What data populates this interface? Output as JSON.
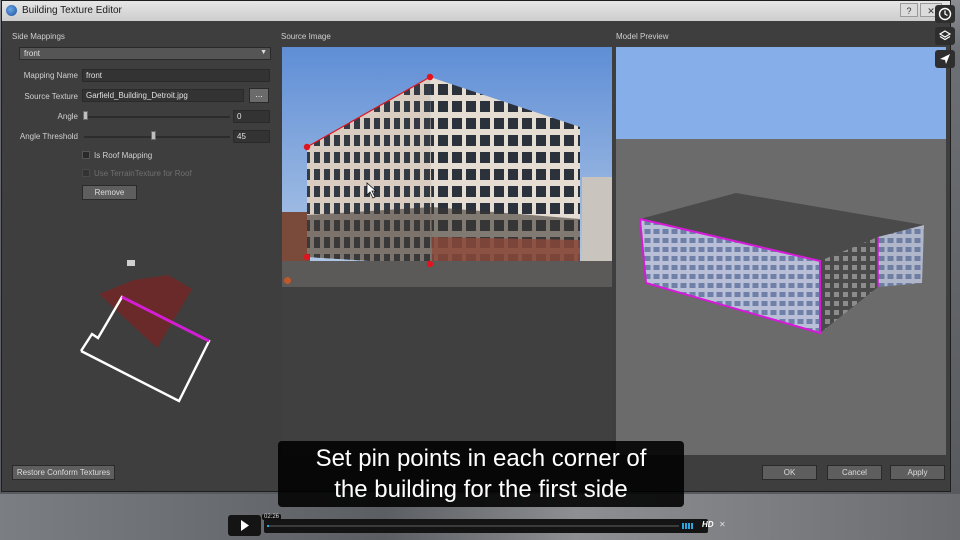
{
  "window": {
    "title": "Building Texture Editor",
    "help_glyph": "?",
    "close_glyph": "✕"
  },
  "side_mappings": {
    "header": "Side Mappings",
    "selected_side": "front",
    "mapping_name_label": "Mapping Name",
    "mapping_name_value": "front",
    "source_texture_label": "Source Texture",
    "source_texture_value": "Garfield_Building_Detroit.jpg",
    "browse_label": "...",
    "angle_label": "Angle",
    "angle_value": "0",
    "angle_threshold_label": "Angle Threshold",
    "angle_threshold_value": "45",
    "is_roof_mapping_label": "Is Roof Mapping",
    "use_terrain_label": "Use TerrainTexture for Roof",
    "remove_label": "Remove",
    "restore_label": "Restore Conform Textures"
  },
  "source_image": {
    "header": "Source Image"
  },
  "model_preview": {
    "header": "Model Preview"
  },
  "dialog_buttons": {
    "ok": "OK",
    "cancel": "Cancel",
    "apply": "Apply"
  },
  "caption": {
    "line1": "Set pin points in each corner of",
    "line2": "the building for the first side"
  },
  "player": {
    "timestamp": "02:26",
    "hd_label": "HD",
    "close_glyph": "✕"
  },
  "colors": {
    "pin": "#e0141e",
    "mapped_edge": "#d51ad8",
    "sky": "#86aee8",
    "preview_floor": "#6b6b6b"
  }
}
